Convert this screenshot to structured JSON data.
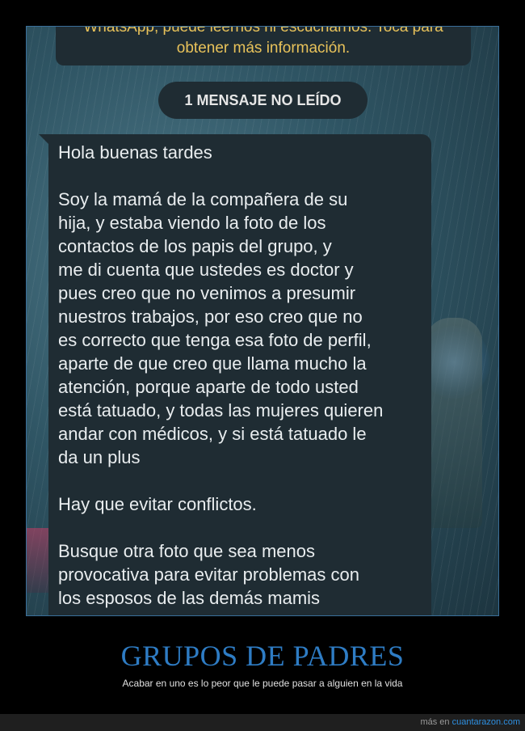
{
  "notice": {
    "line1": "WhatsApp, puede leernos ni escucharnos. Toca para",
    "line2": "obtener más información."
  },
  "unread_label": "1 MENSAJE NO LEÍDO",
  "message": {
    "p1": "Hola buenas tardes",
    "p2": "Soy la mamá de la compañera de su\nhija, y estaba viendo la foto de los\ncontactos de los papis del grupo, y\nme di cuenta que ustedes es doctor y\npues creo que no venimos a presumir\nnuestros trabajos, por eso creo que no\nes correcto que tenga esa foto de perfil,\naparte de que creo que llama mucho la\natención, porque aparte de todo usted\nestá tatuado, y todas las mujeres quieren\nandar con médicos, y si está tatuado le\nda un plus",
    "p3": "Hay que evitar conflictos.",
    "p4": "Busque otra foto que sea menos\nprovocativa para evitar problemas con\nlos esposos de las demás mamis"
  },
  "caption": {
    "title": "GRUPOS DE PADRES",
    "subtitle": "Acabar en uno es lo peor que le puede pasar a alguien en la vida"
  },
  "footer": {
    "prefix": "más en",
    "link": "cuantarazon.com"
  },
  "colors": {
    "notice_text": "#e8c25a",
    "bubble_bg": "#1f2c33",
    "title_blue": "#2e7cc4",
    "link_blue": "#2e8fe0"
  }
}
